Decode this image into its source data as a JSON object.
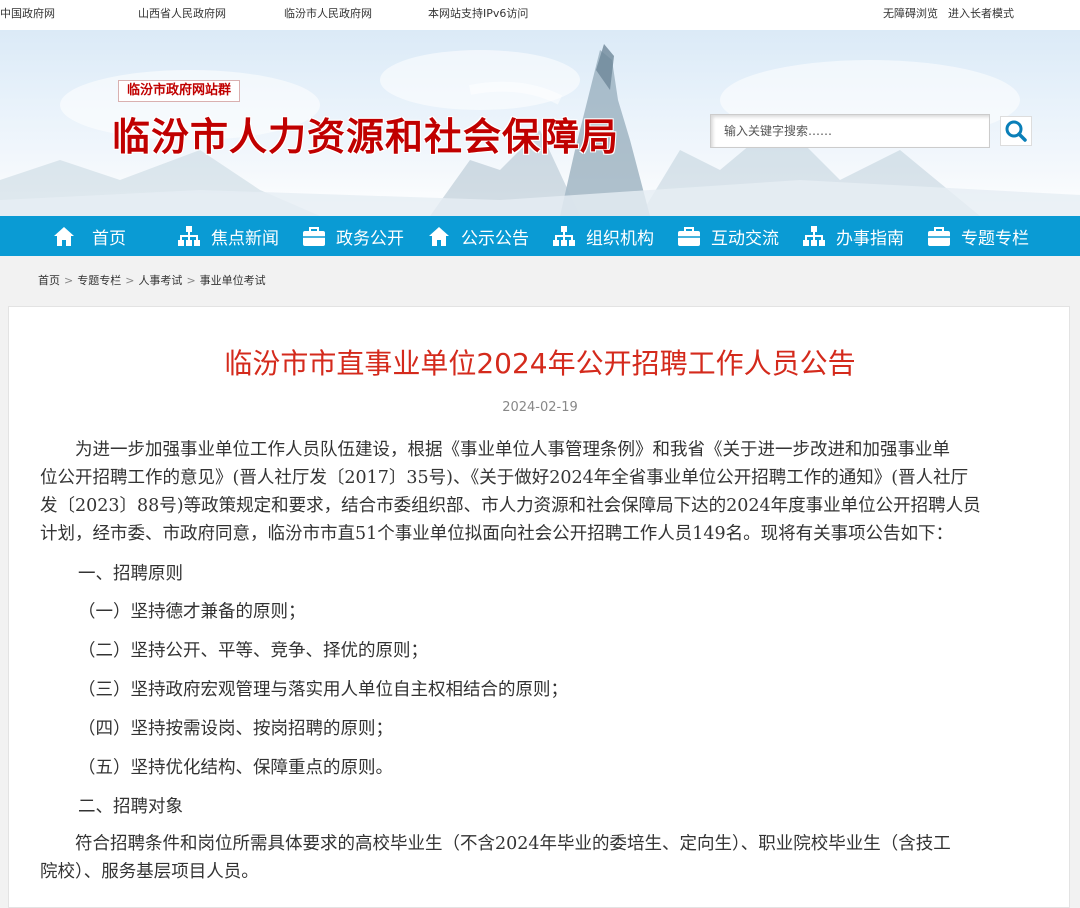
{
  "topbar": {
    "links": [
      "中国政府网",
      "山西省人民政府网",
      "临汾市人民政府网"
    ],
    "ipv6": "本网站支持IPv6访问",
    "accessibility": "无障碍浏览",
    "elder_mode": "进入长者模式"
  },
  "header": {
    "site_group": "临汾市政府网站群",
    "title": "临汾市人力资源和社会保障局",
    "search_placeholder": "输入关键字搜索……"
  },
  "nav": {
    "items": [
      {
        "label": "首页",
        "icon": "home-icon"
      },
      {
        "label": "焦点新闻",
        "icon": "org-chart-icon"
      },
      {
        "label": "政务公开",
        "icon": "briefcase-icon"
      },
      {
        "label": "公示公告",
        "icon": "home-icon"
      },
      {
        "label": "组织机构",
        "icon": "org-chart-icon"
      },
      {
        "label": "互动交流",
        "icon": "briefcase-icon"
      },
      {
        "label": "办事指南",
        "icon": "org-chart-icon"
      },
      {
        "label": "专题专栏",
        "icon": "briefcase-icon"
      }
    ]
  },
  "breadcrumb": [
    "首页",
    "专题专栏",
    "人事考试",
    "事业单位考试"
  ],
  "article": {
    "title": "临汾市市直事业单位2024年公开招聘工作人员公告",
    "date": "2024-02-19",
    "intro_lines": [
      "为进一步加强事业单位工作人员队伍建设，根据《事业单位人事管理条例》和我省《关于进一步改进和加强事业单",
      "位公开招聘工作的意见》(晋人社厅发〔2017〕35号)、《关于做好2024年全省事业单位公开招聘工作的通知》(晋人社厅",
      "发〔2023〕88号)等政策规定和要求，结合市委组织部、市人力资源和社会保障局下达的2024年度事业单位公开招聘人员",
      "计划，经市委、市政府同意，临汾市市直51个事业单位拟面向社会公开招聘工作人员149名。现将有关事项公告如下："
    ],
    "section1": "一、招聘原则",
    "principles": [
      "（一）坚持德才兼备的原则；",
      "（二）坚持公开、平等、竞争、择优的原则；",
      "（三）坚持政府宏观管理与落实用人单位自主权相结合的原则；",
      "（四）坚持按需设岗、按岗招聘的原则；",
      "（五）坚持优化结构、保障重点的原则。"
    ],
    "section2": "二、招聘对象",
    "target_lines": [
      "符合招聘条件和岗位所需具体要求的高校毕业生（不含2024年毕业的委培生、定向生）、职业院校毕业生（含技工",
      "院校）、服务基层项目人员。"
    ]
  },
  "colors": {
    "nav": "#0a9bd4",
    "title_red": "#c00000",
    "article_title": "#d42a1c"
  }
}
